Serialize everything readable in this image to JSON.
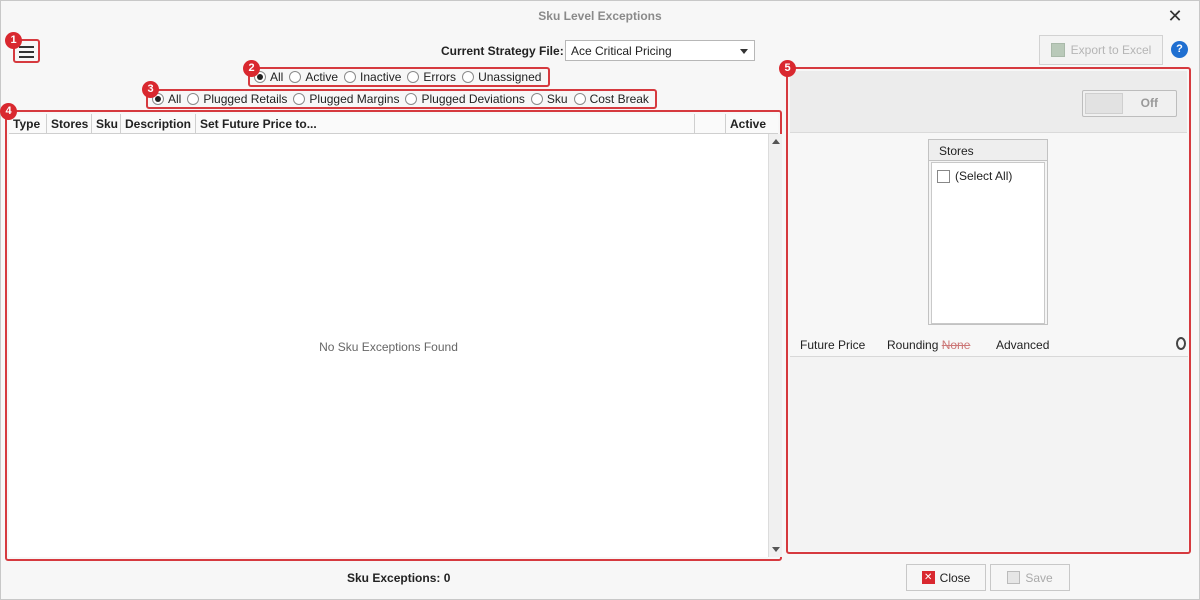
{
  "window": {
    "title": "Sku Level Exceptions",
    "close_glyph": "✕"
  },
  "badges": [
    "1",
    "2",
    "3",
    "4",
    "5"
  ],
  "strategy": {
    "label": "Current Strategy File:",
    "value": "Ace Critical Pricing"
  },
  "status_filter": {
    "options": [
      "All",
      "Active",
      "Inactive",
      "Errors",
      "Unassigned"
    ],
    "selected": "All"
  },
  "type_filter": {
    "options": [
      "All",
      "Plugged Retails",
      "Plugged Margins",
      "Plugged Deviations",
      "Sku",
      "Cost Break"
    ],
    "selected": "All"
  },
  "grid": {
    "columns": [
      "Type",
      "Stores",
      "Sku",
      "Description",
      "Set Future Price to...",
      "",
      "Active"
    ],
    "empty_message": "No Sku Exceptions Found"
  },
  "footer": {
    "exceptions_count": "Sku Exceptions: 0"
  },
  "export": {
    "label": "Export to Excel",
    "icon": "excel-icon"
  },
  "help": {
    "glyph": "?"
  },
  "toggle": {
    "label": "Off"
  },
  "stores": {
    "header": "Stores",
    "select_all": "(Select All)"
  },
  "tabs": {
    "future_price": "Future Price",
    "rounding": "Rounding",
    "rounding_value": "None",
    "advanced": "Advanced"
  },
  "buttons": {
    "close": "Close",
    "save": "Save"
  },
  "colors": {
    "highlight": "#d63a3f",
    "badge": "#d9282f",
    "help": "#1f6fd1"
  }
}
